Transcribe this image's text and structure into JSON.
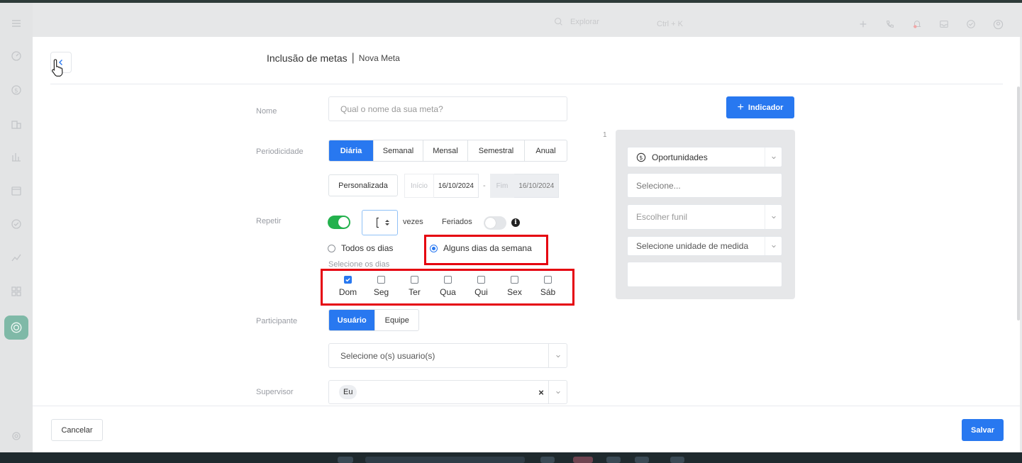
{
  "topbar": {
    "search_placeholder": "Explorar",
    "search_shortcut": "Ctrl + K"
  },
  "header": {
    "title": "Inclusão de metas",
    "separator": "|",
    "subtitle": "Nova Meta"
  },
  "form": {
    "nome": {
      "label": "Nome",
      "placeholder": "Qual o nome da sua meta?"
    },
    "periodicidade": {
      "label": "Periodicidade",
      "options": [
        "Diária",
        "Semanal",
        "Mensal",
        "Semestral",
        "Anual"
      ],
      "selected": "Diária",
      "custom_button": "Personalizada",
      "inicio_label": "Início",
      "inicio_value": "16/10/2024",
      "date_separator": "-",
      "fim_label": "Fim",
      "fim_value": "16/10/2024"
    },
    "repetir": {
      "label": "Repetir",
      "enabled": true,
      "times_unit": "vezes",
      "feriados_label": "Feriados",
      "feriados_enabled": false,
      "info_glyph": "i",
      "todos_label": "Todos os dias",
      "alguns_label": "Alguns dias da semana",
      "selected_option": "Alguns dias da semana",
      "select_days_label": "Selecione os dias",
      "days": [
        {
          "label": "Dom",
          "checked": true
        },
        {
          "label": "Seg",
          "checked": false
        },
        {
          "label": "Ter",
          "checked": false
        },
        {
          "label": "Qua",
          "checked": false
        },
        {
          "label": "Qui",
          "checked": false
        },
        {
          "label": "Sex",
          "checked": false
        },
        {
          "label": "Sáb",
          "checked": false
        }
      ]
    },
    "participante": {
      "label": "Participante",
      "options": [
        "Usuário",
        "Equipe"
      ],
      "selected": "Usuário",
      "users_placeholder": "Selecione o(s) usuario(s)"
    },
    "supervisor": {
      "label": "Supervisor",
      "value": "Eu",
      "clear_glyph": "×"
    }
  },
  "indicator": {
    "add_button": "Indicador",
    "add_glyph": "+",
    "index": "1",
    "type": "Oportunidades",
    "select_placeholder": "Selecione...",
    "funnel_placeholder": "Escolher funil",
    "unit_placeholder": "Selecione unidade de medida"
  },
  "footer": {
    "cancel": "Cancelar",
    "save": "Salvar"
  },
  "colors": {
    "primary": "#2878f0",
    "toggle_on": "#23b14d",
    "highlight": "#e5000f"
  }
}
